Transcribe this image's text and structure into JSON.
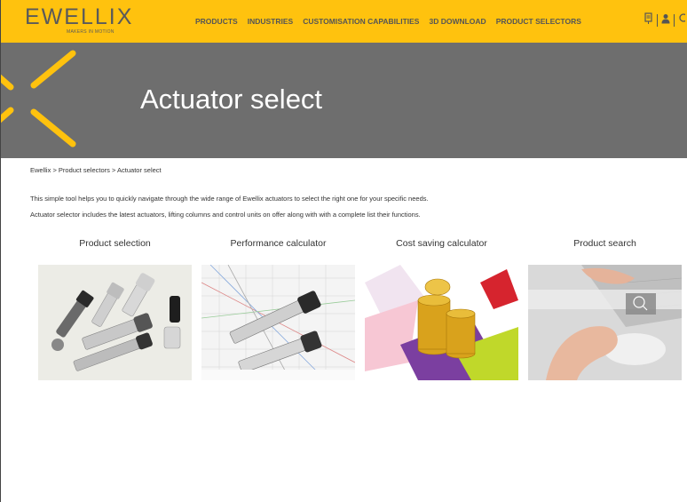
{
  "header": {
    "logo_text": "EWELLIX",
    "logo_tagline": "MAKERS IN MOTION",
    "nav": [
      {
        "label": "PRODUCTS"
      },
      {
        "label": "INDUSTRIES"
      },
      {
        "label": "CUSTOMISATION CAPABILITIES"
      },
      {
        "label": "3D DOWNLOAD"
      },
      {
        "label": "PRODUCT SELECTORS"
      }
    ],
    "icons": [
      "document-download-icon",
      "user-icon",
      "search-icon"
    ]
  },
  "banner": {
    "title": "Actuator select"
  },
  "breadcrumb": {
    "items": [
      "Ewellix",
      "Product selectors",
      "Actuator select"
    ],
    "separator": ">"
  },
  "intro": {
    "line1": "This simple tool helps you to quickly navigate through the wide range of Ewellix actuators to select the right one for your specific needs.",
    "line2": "Actuator selector includes the latest actuators, lifting columns and control units on offer along with with a complete list their functions."
  },
  "cards": [
    {
      "title": "Product selection"
    },
    {
      "title": "Performance calculator"
    },
    {
      "title": "Cost saving calculator"
    },
    {
      "title": "Product search"
    }
  ],
  "colors": {
    "brand_yellow": "#ffc20e",
    "banner_grey": "#6e6e6e",
    "text": "#333333"
  }
}
